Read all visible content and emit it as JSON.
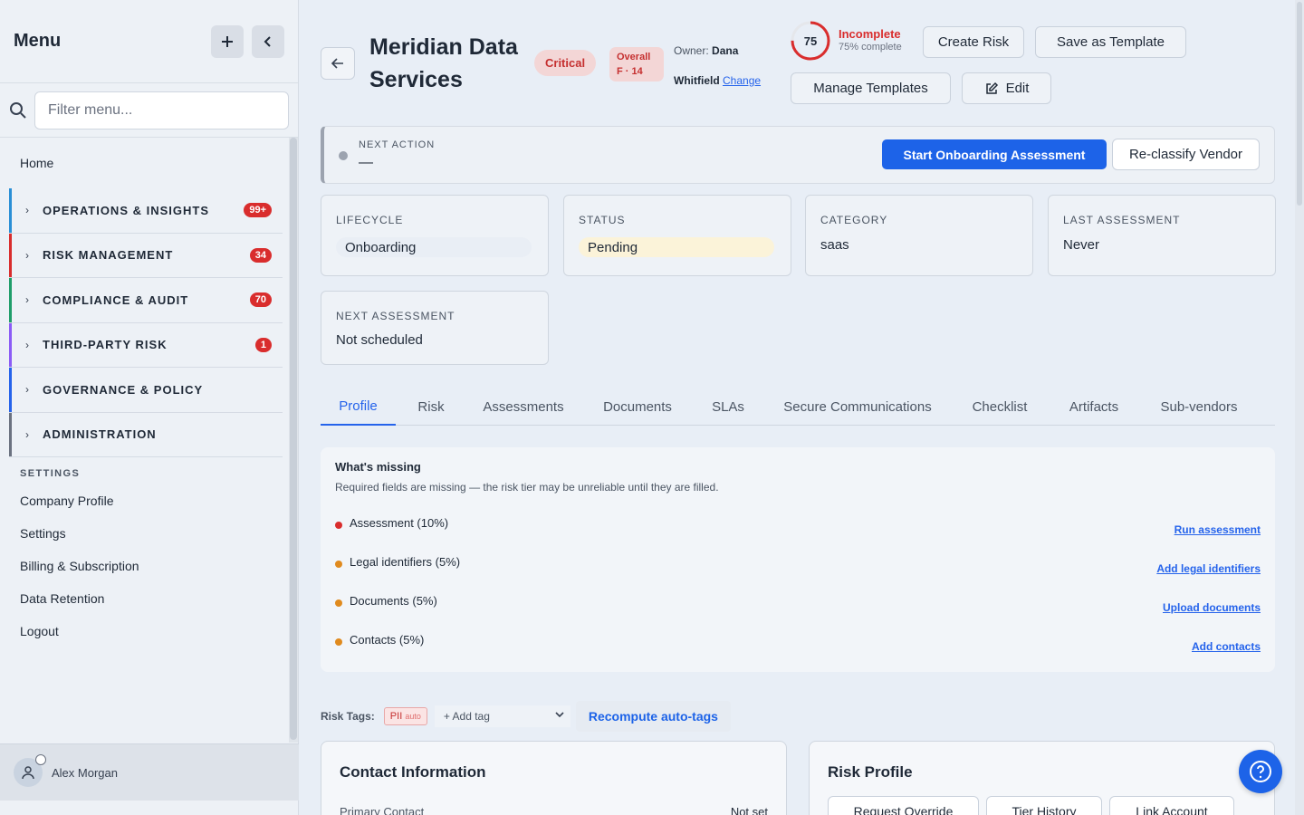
{
  "sidebar": {
    "title": "Menu",
    "filter_placeholder": "Filter menu...",
    "home": "Home",
    "groups": [
      {
        "label": "OPERATIONS & INSIGHTS",
        "badge": "99+",
        "color": "#2a8fd6"
      },
      {
        "label": "RISK MANAGEMENT",
        "badge": "34",
        "color": "#d92d2d"
      },
      {
        "label": "COMPLIANCE & AUDIT",
        "badge": "70",
        "color": "#1f9d6a"
      },
      {
        "label": "THIRD-PARTY RISK",
        "badge": "1",
        "color": "#8b5cf6"
      },
      {
        "label": "GOVERNANCE & POLICY",
        "badge": "",
        "color": "#2563eb"
      },
      {
        "label": "ADMINISTRATION",
        "badge": "",
        "color": "#6b7280"
      }
    ],
    "settings_header": "SETTINGS",
    "settings_items": [
      "Company Profile",
      "Settings",
      "Billing & Subscription",
      "Data Retention",
      "Logout"
    ],
    "user_name": "Alex Morgan"
  },
  "header": {
    "vendor_name": "Meridian Data Services",
    "severity": "Critical",
    "overall_line1": "Overall",
    "overall_line2": "F · 14",
    "owner_label": "Owner:",
    "owner_first": "Dana",
    "owner_last": "Whitfield",
    "change_link": "Change",
    "score": "75",
    "score_percent": 75,
    "score_status": "Incomplete",
    "score_sub": "75% complete",
    "buttons": {
      "create_risk": "Create Risk",
      "save_template": "Save as Template",
      "manage_templates": "Manage Templates",
      "edit": "Edit"
    }
  },
  "next_action": {
    "label": "NEXT ACTION",
    "value": "—",
    "primary_button": "Start Onboarding Assessment",
    "secondary_button": "Re-classify Vendor"
  },
  "cards": [
    {
      "label": "LIFECYCLE",
      "value": "Onboarding"
    },
    {
      "label": "STATUS",
      "value": "Pending"
    },
    {
      "label": "CATEGORY",
      "value": "saas"
    },
    {
      "label": "LAST ASSESSMENT",
      "value": "Never"
    },
    {
      "label": "NEXT ASSESSMENT",
      "value": "Not scheduled"
    }
  ],
  "tabs": [
    "Profile",
    "Risk",
    "Assessments",
    "Documents",
    "SLAs",
    "Secure Communications",
    "Checklist",
    "Artifacts",
    "Sub-vendors"
  ],
  "missing": {
    "title": "What's missing",
    "subtitle": "Required fields are missing — the risk tier may be unreliable until they are filled.",
    "items": [
      {
        "label": "Assessment (10%)",
        "link": "Run assessment",
        "color": "#d92d2d"
      },
      {
        "label": "Legal identifiers (5%)",
        "link": "Add legal identifiers",
        "color": "#e08a1e"
      },
      {
        "label": "Documents (5%)",
        "link": "Upload documents",
        "color": "#e08a1e"
      },
      {
        "label": "Contacts (5%)",
        "link": "Add contacts",
        "color": "#e08a1e"
      }
    ]
  },
  "risk_tags": {
    "label": "Risk Tags:",
    "tag": "PII",
    "tag_suffix": "auto",
    "add_tag": "+ Add tag",
    "recompute": "Recompute auto-tags"
  },
  "contact_panel": {
    "title": "Contact Information",
    "primary_label": "Primary Contact",
    "primary_value": "Not set"
  },
  "risk_panel": {
    "title": "Risk Profile",
    "buttons": [
      "Request Override",
      "Tier History",
      "Link Account"
    ]
  }
}
